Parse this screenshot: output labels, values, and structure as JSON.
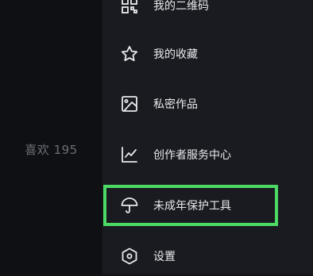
{
  "left_panel": {
    "likes_text": "喜欢 195"
  },
  "menu": {
    "items": [
      {
        "label": "我的二维码",
        "icon": "qr-code-icon"
      },
      {
        "label": "我的收藏",
        "icon": "star-icon"
      },
      {
        "label": "私密作品",
        "icon": "image-icon"
      },
      {
        "label": "创作者服务中心",
        "icon": "chart-icon"
      },
      {
        "label": "未成年保护工具",
        "icon": "umbrella-icon"
      },
      {
        "label": "设置",
        "icon": "hexagon-settings-icon"
      }
    ]
  },
  "colors": {
    "highlight": "#4cd964"
  }
}
